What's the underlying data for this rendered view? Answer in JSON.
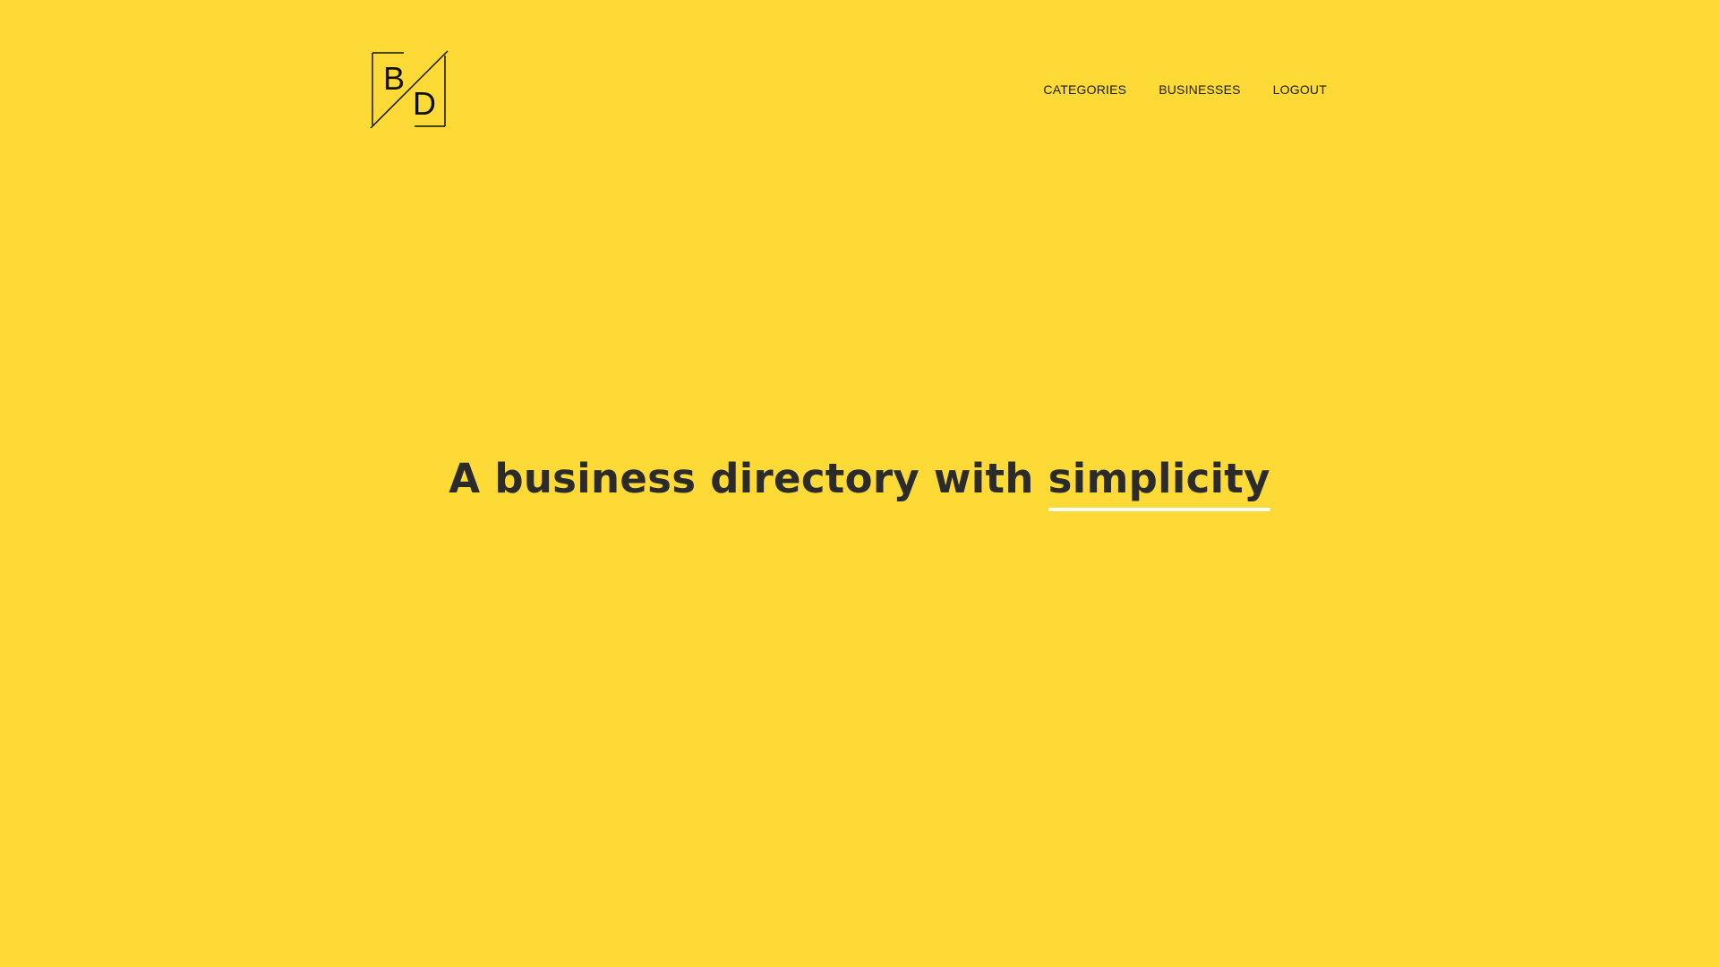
{
  "brand": {
    "logo_letter_top": "B",
    "logo_letter_bottom": "D"
  },
  "nav": {
    "items": [
      {
        "label": "CATEGORIES"
      },
      {
        "label": "BUSINESSES"
      },
      {
        "label": "LOGOUT"
      }
    ]
  },
  "hero": {
    "title_prefix": "A business directory with",
    "title_highlight": "simplicity"
  },
  "colors": {
    "background": "#FDDA35",
    "text": "#2b2b2b",
    "underline": "#ffffff"
  }
}
